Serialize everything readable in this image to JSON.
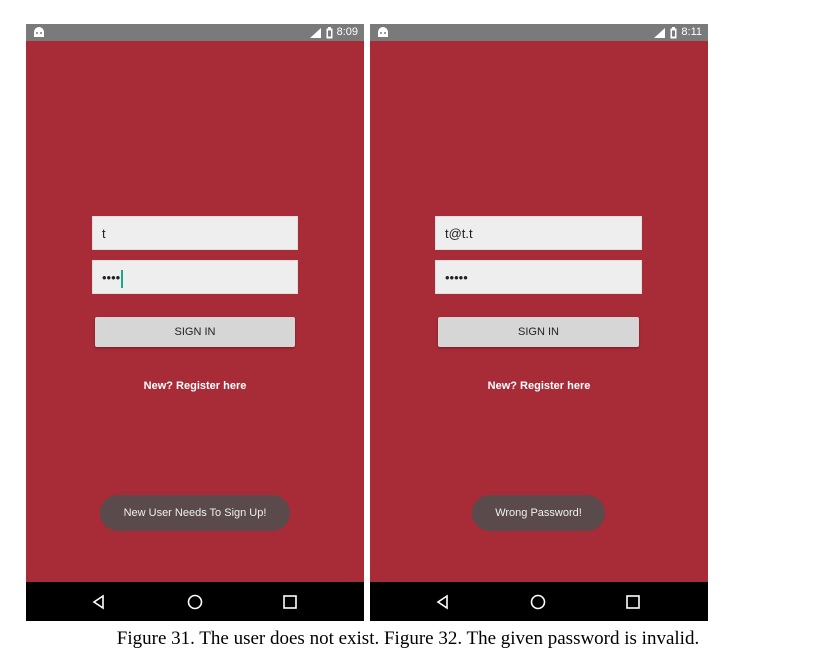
{
  "colors": {
    "screen_background": "#a82b38",
    "status_bar": "#7a7a7a",
    "nav_bar": "#000000",
    "toast_background": "#5a4a4c",
    "text_cursor": "#1aa78a"
  },
  "screens": [
    {
      "status": {
        "time": "8:09",
        "icons": [
          "android-icon",
          "signal-icon",
          "battery-icon"
        ]
      },
      "email_value": "t",
      "password_value": "••••",
      "password_focused": true,
      "signin_label": "SIGN IN",
      "register_link": "New? Register here",
      "toast": "New User Needs To Sign Up!"
    },
    {
      "status": {
        "time": "8:11",
        "icons": [
          "android-icon",
          "signal-icon",
          "battery-icon"
        ]
      },
      "email_value": "t@t.t",
      "password_value": "•••••",
      "password_focused": false,
      "signin_label": "SIGN IN",
      "register_link": "New? Register here",
      "toast": "Wrong Password!"
    }
  ],
  "nav_buttons": [
    "back-icon",
    "home-icon",
    "recents-icon"
  ],
  "caption": "Figure 31. The user does not exist. Figure 32. The given password is invalid."
}
